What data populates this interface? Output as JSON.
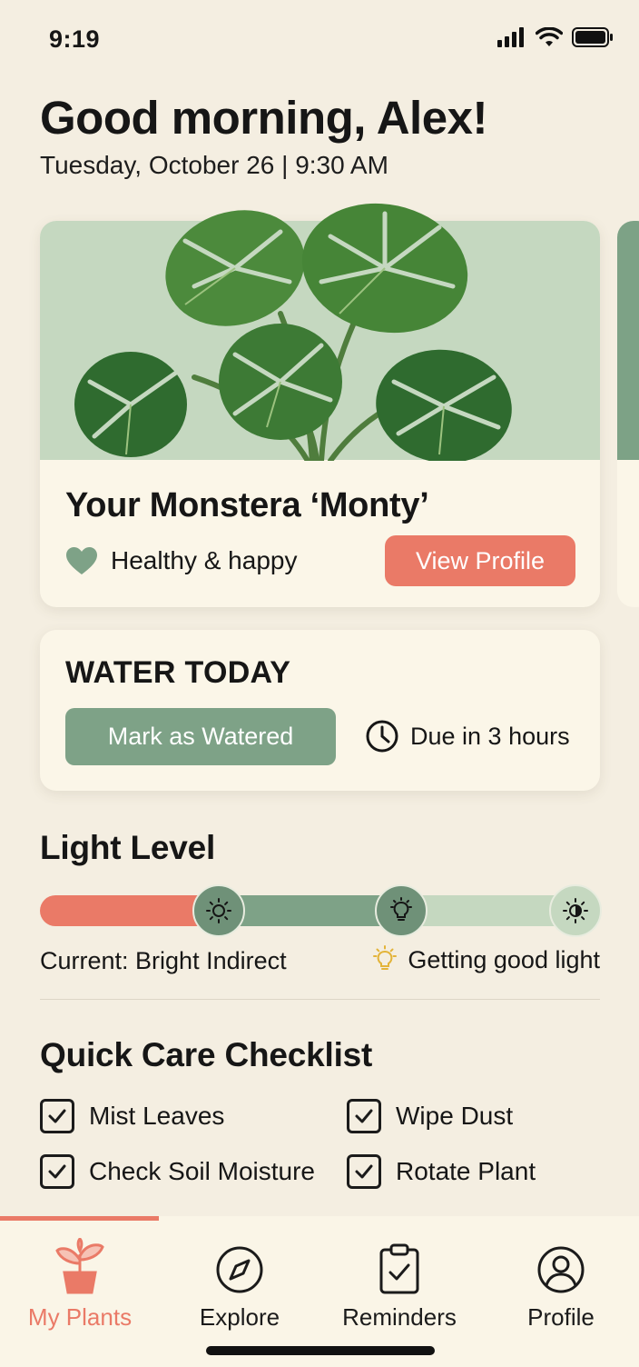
{
  "status_bar": {
    "time": "9:19"
  },
  "header": {
    "greeting": "Good morning, Alex!",
    "date": "Tuesday, October 26 | 9:30 AM"
  },
  "plant_card": {
    "name": "Your Monstera ‘Monty’",
    "health": "Healthy & happy",
    "view_profile_label": "View Profile"
  },
  "water_card": {
    "title": "WATER TODAY",
    "button_label": "Mark as Watered",
    "due": "Due in 3 hours"
  },
  "light": {
    "title": "Light Level",
    "current": "Current: Bright Indirect",
    "status": "Getting good light"
  },
  "checklist": {
    "title": "Quick Care Checklist",
    "items": [
      {
        "label": "Mist Leaves",
        "checked": true
      },
      {
        "label": "Wipe Dust",
        "checked": true
      },
      {
        "label": "Check Soil Moisture",
        "checked": true
      },
      {
        "label": "Rotate Plant",
        "checked": true
      }
    ]
  },
  "nav": {
    "items": [
      {
        "label": "My Plants",
        "icon": "plant-icon",
        "active": true
      },
      {
        "label": "Explore",
        "icon": "compass-icon",
        "active": false
      },
      {
        "label": "Reminders",
        "icon": "clipboard-check-icon",
        "active": false
      },
      {
        "label": "Profile",
        "icon": "user-icon",
        "active": false
      }
    ]
  },
  "colors": {
    "background": "#f4eee1",
    "card": "#fbf6e8",
    "accent_coral": "#ea7a67",
    "accent_sage": "#7ea287",
    "light_sage": "#c5d8c0"
  }
}
